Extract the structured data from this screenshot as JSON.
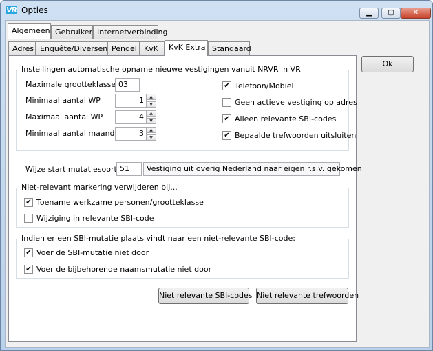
{
  "window": {
    "title": "Opties",
    "app_icon_text": "VR"
  },
  "tabs_top": [
    "Algemeen",
    "Gebruiker",
    "Internetverbinding"
  ],
  "tabs_sub": [
    "Adres",
    "Enquête/Diversen",
    "Pendel",
    "KvK",
    "KvK Extra",
    "Standaard"
  ],
  "ok_label": "Ok",
  "group1": {
    "label": "Instellingen automatische opname nieuwe vestigingen vanuit NRVR in VR",
    "max_grootteklasse_label": "Maximale grootteklasse",
    "max_grootteklasse_value": "03",
    "min_wp_label": "Minimaal aantal WP",
    "min_wp_value": "1",
    "max_wp_label": "Maximaal aantal WP",
    "max_wp_value": "4",
    "min_maanden_label": "Minimaal aantal maanden",
    "min_maanden_value": "3",
    "cb_telefoon": {
      "label": "Telefoon/Mobiel",
      "checked": "✔"
    },
    "cb_geen_actieve": {
      "label": "Geen actieve vestiging op adres",
      "checked": ""
    },
    "cb_alleen_relevante": {
      "label": "Alleen relevante SBI-codes",
      "checked": "✔"
    },
    "cb_trefwoorden": {
      "label": "Bepaalde trefwoorden uitsluiten",
      "checked": "✔"
    }
  },
  "mutatie": {
    "label": "Wijze start mutatiesoort B",
    "code": "51",
    "description": "Vestiging uit overig Nederland naar eigen r.s.v. gekomen"
  },
  "group2": {
    "label": "Niet-relevant markering verwijderen bij...",
    "cb_toename": {
      "label": "Toename werkzame personen/grootteklasse",
      "checked": "✔"
    },
    "cb_wijziging": {
      "label": "Wijziging in relevante SBI-code",
      "checked": ""
    }
  },
  "group3": {
    "label": "Indien er een SBI-mutatie plaats vindt naar een niet-relevante SBI-code:",
    "cb_sbi_niet_door": {
      "label": "Voer de SBI-mutatie niet door",
      "checked": "✔"
    },
    "cb_naams_niet_door": {
      "label": "Voer de bijbehorende naamsmutatie niet door",
      "checked": "✔"
    }
  },
  "buttons": {
    "niet_relevante_sbi": "Niet relevante SBI-codes",
    "niet_relevante_trefwoorden": "Niet relevante trefwoorden"
  }
}
